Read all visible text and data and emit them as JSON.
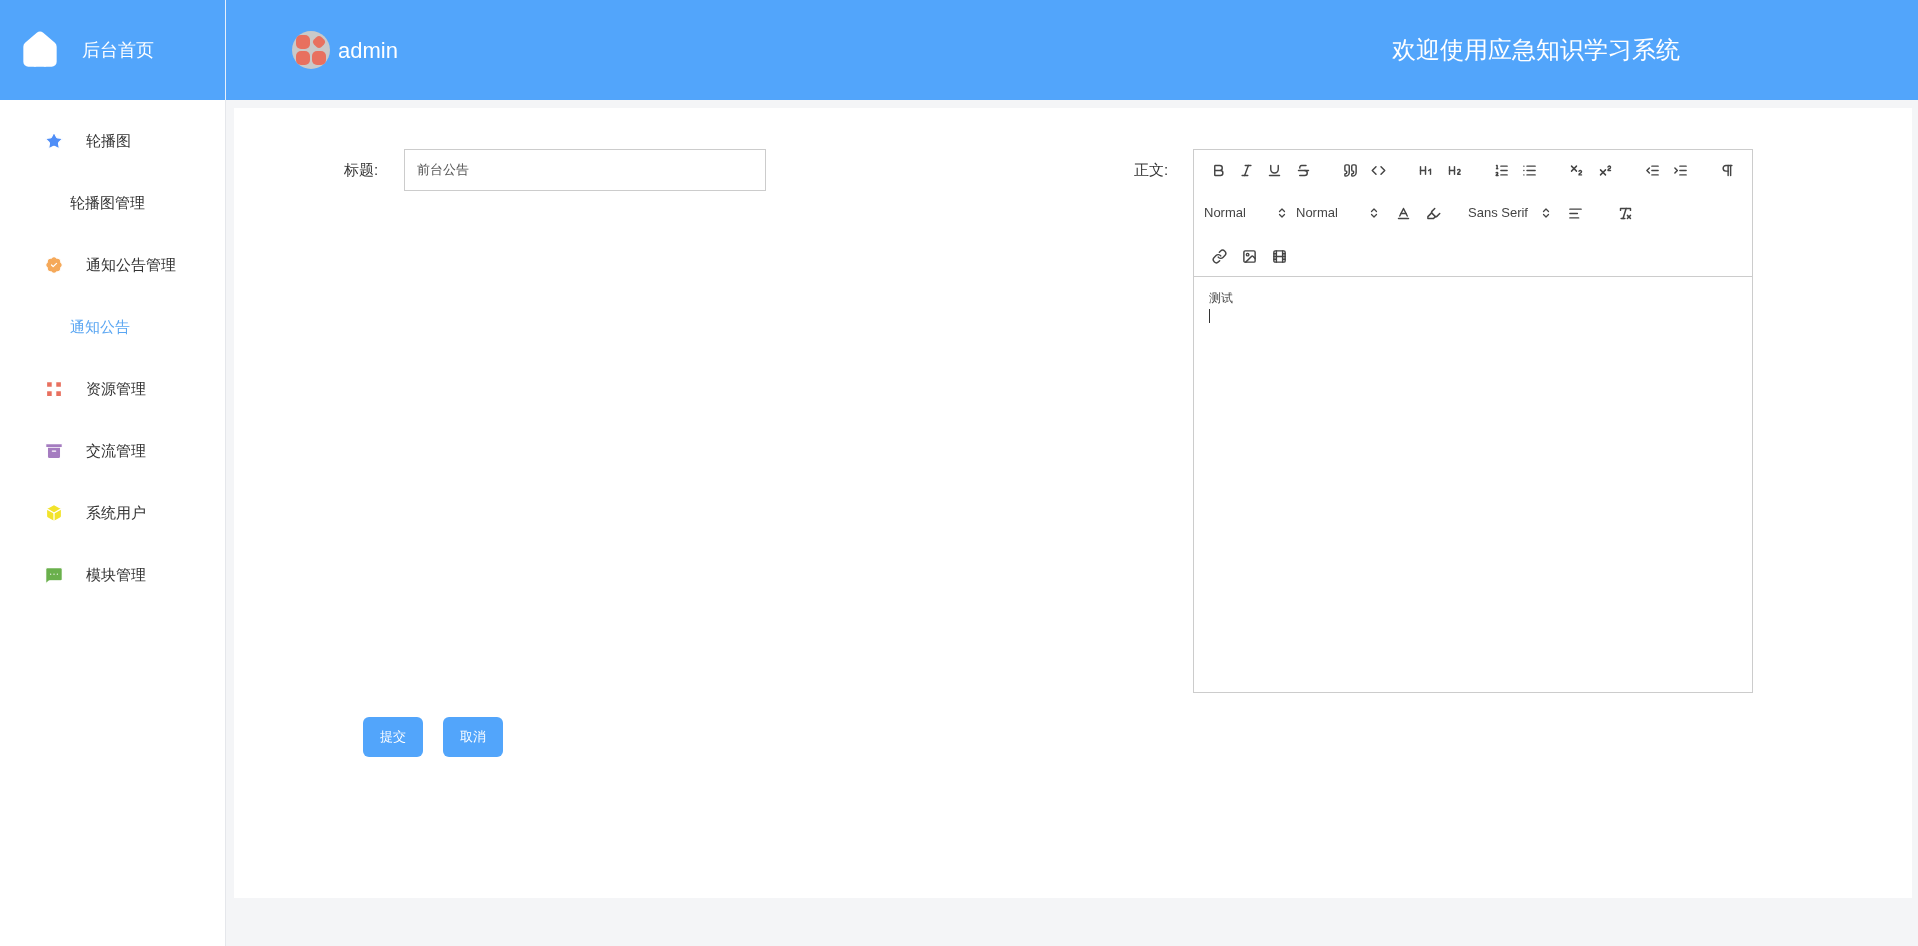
{
  "brand": {
    "label": "后台首页"
  },
  "user": {
    "name": "admin"
  },
  "header": {
    "title": "欢迎使用应急知识学习系统"
  },
  "sidebar": {
    "groups": [
      {
        "kind": "star",
        "color": "#4f8ef7",
        "label": "轮播图",
        "children": [
          {
            "label": "轮播图管理",
            "selected": false
          }
        ]
      },
      {
        "kind": "badge",
        "color": "#f5a95a",
        "label": "通知公告管理",
        "children": [
          {
            "label": "通知公告",
            "selected": true
          }
        ]
      },
      {
        "kind": "grid",
        "color": "#e8705f",
        "label": "资源管理"
      },
      {
        "kind": "archive",
        "color": "#a57cc0",
        "label": "交流管理"
      },
      {
        "kind": "cube",
        "color": "#f2e32b",
        "label": "系统用户"
      },
      {
        "kind": "chat",
        "color": "#6ab04c",
        "label": "模块管理"
      }
    ]
  },
  "form": {
    "title_label": "标题:",
    "title_value": "前台公告",
    "body_label": "正文:",
    "body_text": "测试",
    "toolbar": [
      [
        {
          "kind": "bold"
        },
        {
          "kind": "italic"
        },
        {
          "kind": "underline"
        },
        {
          "kind": "strike"
        },
        {
          "kind": "gap"
        },
        {
          "kind": "quote"
        },
        {
          "kind": "code"
        },
        {
          "kind": "gap"
        },
        {
          "kind": "h1"
        },
        {
          "kind": "h2"
        },
        {
          "kind": "gap"
        },
        {
          "kind": "ordered-list"
        },
        {
          "kind": "bullet-list"
        },
        {
          "kind": "gap"
        },
        {
          "kind": "subscript"
        },
        {
          "kind": "superscript"
        },
        {
          "kind": "gap"
        },
        {
          "kind": "outdent"
        },
        {
          "kind": "indent"
        },
        {
          "kind": "gap"
        },
        {
          "kind": "direction"
        }
      ],
      [
        {
          "kind": "select",
          "value": "Normal"
        },
        {
          "kind": "select",
          "value": "Normal"
        },
        {
          "kind": "color"
        },
        {
          "kind": "background"
        },
        {
          "kind": "gap"
        },
        {
          "kind": "select",
          "value": "Sans Serif"
        },
        {
          "kind": "align"
        },
        {
          "kind": "gap"
        },
        {
          "kind": "clean"
        }
      ],
      [
        {
          "kind": "link"
        },
        {
          "kind": "image"
        },
        {
          "kind": "video"
        }
      ]
    ],
    "buttons": [
      "提交",
      "取消"
    ]
  }
}
